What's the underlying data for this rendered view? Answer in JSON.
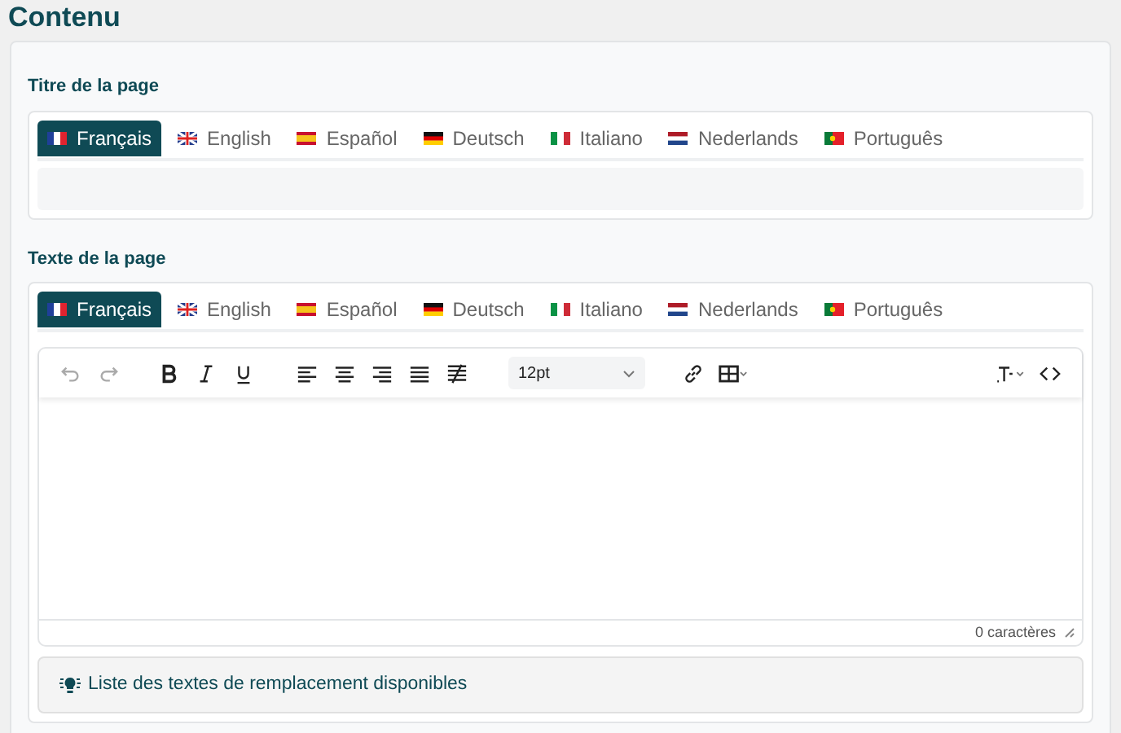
{
  "heading": "Contenu",
  "title_field": {
    "label": "Titre de la page",
    "tabs": [
      {
        "label": "Français",
        "selected": true
      },
      {
        "label": "English",
        "selected": false
      },
      {
        "label": "Español",
        "selected": false
      },
      {
        "label": "Deutsch",
        "selected": false
      },
      {
        "label": "Italiano",
        "selected": false
      },
      {
        "label": "Nederlands",
        "selected": false
      },
      {
        "label": "Português",
        "selected": false
      }
    ]
  },
  "text_field": {
    "label": "Texte de la page",
    "tabs": [
      {
        "label": "Français",
        "selected": true
      },
      {
        "label": "English",
        "selected": false
      },
      {
        "label": "Español",
        "selected": false
      },
      {
        "label": "Deutsch",
        "selected": false
      },
      {
        "label": "Italiano",
        "selected": false
      },
      {
        "label": "Nederlands",
        "selected": false
      },
      {
        "label": "Português",
        "selected": false
      }
    ],
    "editor": {
      "undo": {
        "disabled": true
      },
      "redo": {
        "disabled": true
      },
      "font_size": "12pt",
      "char_count": "0 caractères"
    }
  },
  "placeholders_link": "Liste des textes de remplacement disponibles"
}
